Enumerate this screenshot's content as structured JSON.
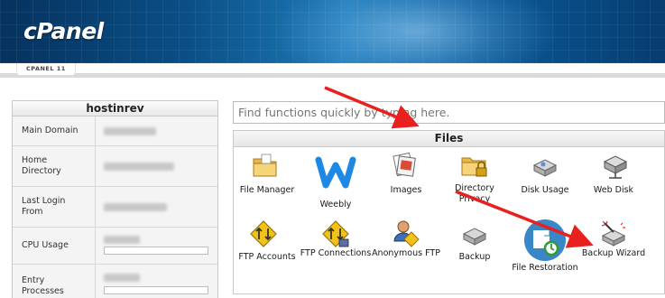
{
  "header": {
    "logo": "cPanel",
    "version_tab": "CPANEL 11"
  },
  "sidebar": {
    "username": "hostinrev",
    "rows": [
      {
        "label": "Main Domain"
      },
      {
        "label": "Home Directory"
      },
      {
        "label": "Last Login From"
      },
      {
        "label": "CPU Usage"
      },
      {
        "label": "Entry Processes"
      }
    ]
  },
  "search": {
    "placeholder": "Find functions quickly by typing here."
  },
  "files": {
    "title": "Files",
    "tools": [
      {
        "label": "File Manager",
        "icon": "folder-icon"
      },
      {
        "label": "Weebly",
        "icon": "weebly-icon"
      },
      {
        "label": "Images",
        "icon": "images-icon"
      },
      {
        "label": "Directory Privacy",
        "icon": "directory-privacy-icon"
      },
      {
        "label": "Disk Usage",
        "icon": "disk-usage-icon"
      },
      {
        "label": "Web Disk",
        "icon": "web-disk-icon"
      },
      {
        "label": "FTP Accounts",
        "icon": "ftp-accounts-icon"
      },
      {
        "label": "FTP Connections",
        "icon": "ftp-connections-icon"
      },
      {
        "label": "Anonymous FTP",
        "icon": "anonymous-ftp-icon"
      },
      {
        "label": "Backup",
        "icon": "backup-icon"
      },
      {
        "label": "File Restoration",
        "icon": "file-restoration-icon"
      },
      {
        "label": "Backup Wizard",
        "icon": "backup-wizard-icon"
      }
    ]
  },
  "colors": {
    "arrow": "#e8201e",
    "banner": "#0a4f86",
    "weebly": "#1e88e5",
    "restore": "#3a87c7"
  }
}
